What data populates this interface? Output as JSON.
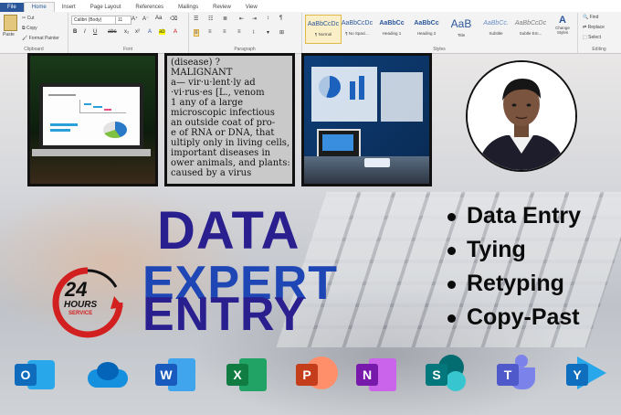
{
  "ribbon": {
    "tabs": [
      "File",
      "Home",
      "Insert",
      "Page Layout",
      "References",
      "Mailings",
      "Review",
      "View"
    ],
    "clipboard": {
      "paste": "Paste",
      "cut": "Cut",
      "copy": "Copy",
      "format_painter": "Format Painter",
      "label": "Clipboard"
    },
    "font": {
      "name": "Calibri (Body)",
      "size": "11",
      "label": "Font"
    },
    "paragraph": {
      "label": "Paragraph"
    },
    "styles": {
      "items": [
        {
          "sample": "AaBbCcDc",
          "name": "¶ Normal"
        },
        {
          "sample": "AaBbCcDc",
          "name": "¶ No Spaci..."
        },
        {
          "sample": "AaBbCc",
          "name": "Heading 1"
        },
        {
          "sample": "AaBbCc",
          "name": "Heading 2"
        },
        {
          "sample": "AaB",
          "name": "Title"
        },
        {
          "sample": "AaBbCc.",
          "name": "Subtitle"
        },
        {
          "sample": "AaBbCcDc",
          "name": "Subtle Em..."
        }
      ],
      "change": "Change Styles",
      "label": "Styles"
    },
    "editing": {
      "find": "Find",
      "replace": "Replace",
      "select": "Select",
      "label": "Editing"
    }
  },
  "dictionary": {
    "lines": [
      "(disease) ?",
      "MALIGNANT",
      "a— vir·u·lent·ly ad",
      "·vi·rus·es [L., venom",
      "1 any of a large",
      "microscopic infectious",
      "an outside coat of pro-",
      "e of RNA or DNA, that",
      "ultiply only in living cells,",
      "important diseases in",
      "ower animals, and plants:",
      "caused by a virus"
    ]
  },
  "headline": {
    "line1": "DATA",
    "line2": "EXPERT",
    "line3": "ENTRY"
  },
  "badge": {
    "number": "24",
    "hours": "HOURS",
    "service": "SERVICE"
  },
  "services": [
    "Data Entry",
    "Tying",
    "Retyping",
    "Copy-Past"
  ],
  "apps": [
    {
      "icon": "outlook-icon",
      "letter": "O",
      "color": "#0f6cbd"
    },
    {
      "icon": "onedrive-icon",
      "letter": "",
      "color": "#1490df"
    },
    {
      "icon": "word-icon",
      "letter": "W",
      "color": "#185abd"
    },
    {
      "icon": "excel-icon",
      "letter": "X",
      "color": "#107c41"
    },
    {
      "icon": "powerpoint-icon",
      "letter": "P",
      "color": "#c43e1c"
    },
    {
      "icon": "onenote-icon",
      "letter": "N",
      "color": "#7719aa"
    },
    {
      "icon": "sharepoint-icon",
      "letter": "S",
      "color": "#03787c"
    },
    {
      "icon": "teams-icon",
      "letter": "T",
      "color": "#5059c9"
    },
    {
      "icon": "yammer-icon",
      "letter": "Y",
      "color": "#106ebe"
    }
  ],
  "colors": {
    "headline_dark": "#2a1f8f",
    "headline_blue": "#1f46b5",
    "badge_red": "#d21f1f"
  }
}
